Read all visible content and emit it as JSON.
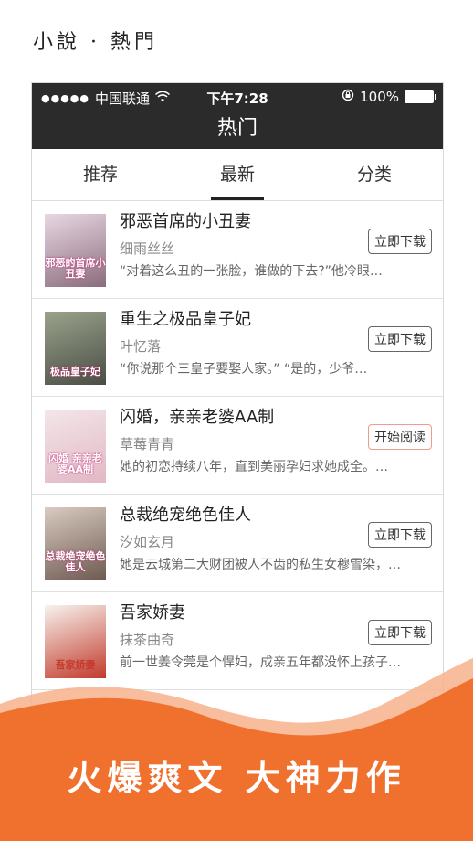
{
  "page_header": "小說 · 熱門",
  "status_bar": {
    "carrier": "中国联通",
    "time": "下午7:28",
    "battery": "100%"
  },
  "nav_title": "热门",
  "tabs": [
    {
      "label": "推荐",
      "active": false
    },
    {
      "label": "最新",
      "active": true
    },
    {
      "label": "分类",
      "active": false
    }
  ],
  "books": [
    {
      "title": "邪恶首席的小丑妻",
      "author": "细雨丝丝",
      "summary": "“对着这么丑的一张脸，谁做的下去?”他冷眼…",
      "action": "立即下载",
      "cover_text": "邪恶的首席小丑妻",
      "cover_colors": [
        "#e9d7e4",
        "#8a6c7d"
      ]
    },
    {
      "title": "重生之极品皇子妃",
      "author": "叶忆落",
      "summary": "“你说那个三皇子要娶人家。” “是的，少爷…",
      "action": "立即下载",
      "cover_text": "极品皇子妃",
      "cover_colors": [
        "#9aa28b",
        "#4a4e45"
      ]
    },
    {
      "title": "闪婚，亲亲老婆AA制",
      "author": "草莓青青",
      "summary": "她的初恋持续八年，直到美丽孕妇求她成全。…",
      "action": "开始阅读",
      "cover_text": "闪婚 亲亲老婆AA制",
      "cover_colors": [
        "#f3e6e9",
        "#e2b7c4"
      ]
    },
    {
      "title": "总裁绝宠绝色佳人",
      "author": "汐如玄月",
      "summary": "她是云城第二大财团被人不齿的私生女穆雪染，…",
      "action": "立即下载",
      "cover_text": "总裁绝宠绝色佳人",
      "cover_colors": [
        "#d9cbc1",
        "#6d5a51"
      ]
    },
    {
      "title": "吾家娇妻",
      "author": "抹茶曲奇",
      "summary": "前一世姜令莞是个悍妇，成亲五年都没怀上孩子…",
      "action": "立即下载",
      "cover_text": "吾家娇妻",
      "cover_colors": [
        "#f7f3ee",
        "#c23a2b"
      ]
    }
  ],
  "slogan": "火爆爽文 大神力作",
  "colors": {
    "dark_bar": "#2b2b2b",
    "accent_orange": "#f0702e",
    "reading_border": "#f29a8c"
  },
  "icons": [
    "signal-icon",
    "wifi-icon",
    "lock-rotation-icon",
    "battery-icon"
  ]
}
